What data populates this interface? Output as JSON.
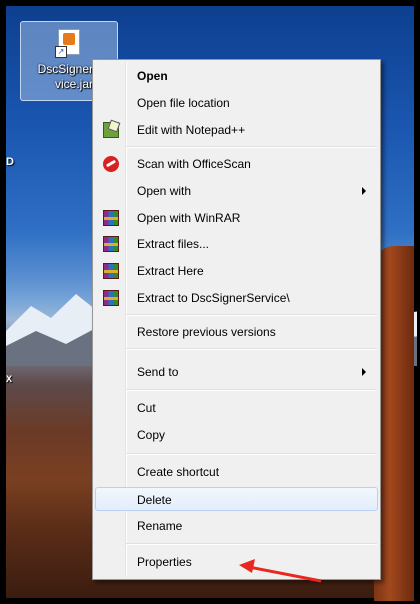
{
  "desktop": {
    "icon_label_line1": "DscSigner",
    "icon_label_line2": "vice.jar",
    "edge_text_1": "D",
    "edge_text_2": "X"
  },
  "menu": {
    "items": [
      {
        "label": "Open",
        "bold": true
      },
      {
        "label": "Open file location"
      },
      {
        "label": "Edit with Notepad++",
        "icon": "notepadpp-icon"
      },
      {
        "label": "Scan with OfficeScan",
        "icon": "officescan-icon"
      },
      {
        "label": "Open with",
        "submenu": true
      },
      {
        "label": "Open with WinRAR",
        "icon": "winrar-icon"
      },
      {
        "label": "Extract files...",
        "icon": "winrar-icon"
      },
      {
        "label": "Extract Here",
        "icon": "winrar-icon"
      },
      {
        "label": "Extract to DscSignerService\\",
        "icon": "winrar-icon"
      },
      {
        "label": "Restore previous versions"
      },
      {
        "label": "Send to",
        "submenu": true
      },
      {
        "label": "Cut"
      },
      {
        "label": "Copy"
      },
      {
        "label": "Create shortcut"
      },
      {
        "label": "Delete",
        "highlighted": true
      },
      {
        "label": "Rename"
      },
      {
        "label": "Properties"
      }
    ]
  },
  "annotation": {
    "arrow_color": "#e8281e",
    "points_to": "Properties"
  },
  "colors": {
    "menu_bg": "#f0f0f0",
    "hover_border": "#b8d1f1"
  }
}
